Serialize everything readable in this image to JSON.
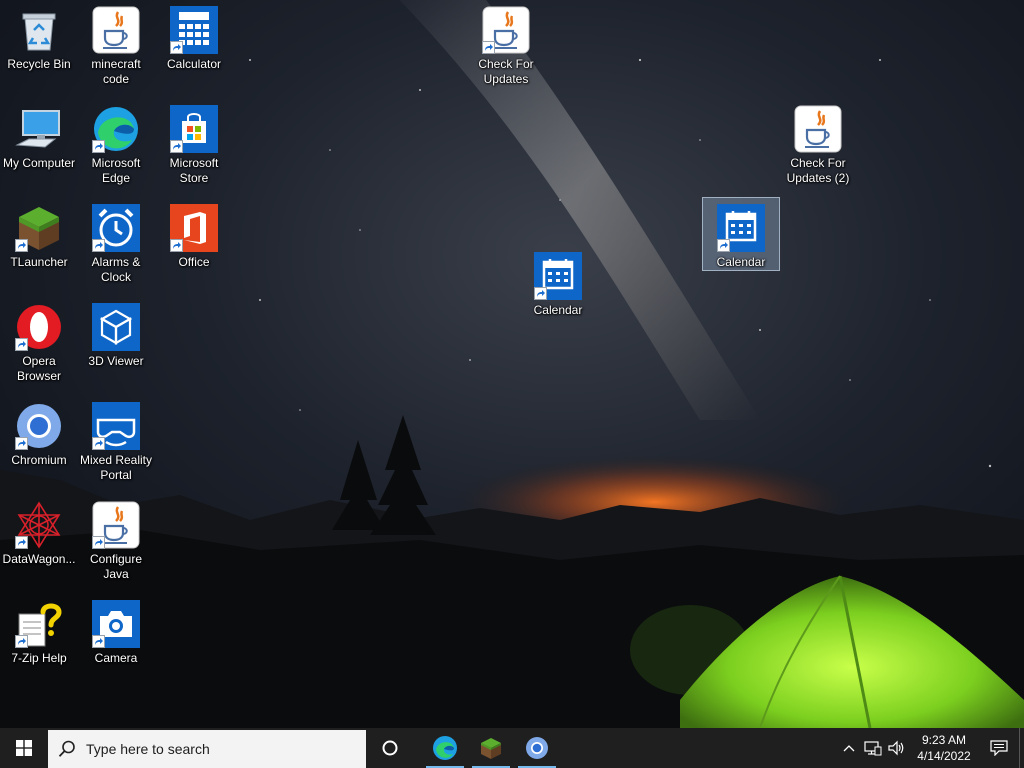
{
  "desktop": {
    "icons": [
      {
        "id": "recycle-bin",
        "label": "Recycle Bin",
        "icon": "recycle-bin-icon",
        "shortcut": false
      },
      {
        "id": "minecraft-code",
        "label": "minecraft code",
        "icon": "java-icon",
        "shortcut": false
      },
      {
        "id": "calculator",
        "label": "Calculator",
        "icon": "calculator-icon",
        "shortcut": true
      },
      {
        "id": "check-updates",
        "label": "Check For Updates",
        "icon": "java-icon",
        "shortcut": true
      },
      {
        "id": "my-computer",
        "label": "My Computer",
        "icon": "computer-icon",
        "shortcut": false
      },
      {
        "id": "edge",
        "label": "Microsoft Edge",
        "icon": "edge-icon",
        "shortcut": true
      },
      {
        "id": "store",
        "label": "Microsoft Store",
        "icon": "store-icon",
        "shortcut": true
      },
      {
        "id": "check-updates-2",
        "label": "Check For Updates (2)",
        "icon": "java-icon",
        "shortcut": false
      },
      {
        "id": "tlauncher",
        "label": "TLauncher",
        "icon": "grass-block-icon",
        "shortcut": true
      },
      {
        "id": "alarms",
        "label": "Alarms & Clock",
        "icon": "alarm-clock-icon",
        "shortcut": true
      },
      {
        "id": "office",
        "label": "Office",
        "icon": "office-icon",
        "shortcut": true
      },
      {
        "id": "calendar-selected",
        "label": "Calendar",
        "icon": "calendar-icon",
        "shortcut": true
      },
      {
        "id": "calendar",
        "label": "Calendar",
        "icon": "calendar-icon",
        "shortcut": true
      },
      {
        "id": "opera",
        "label": "Opera Browser",
        "icon": "opera-icon",
        "shortcut": true
      },
      {
        "id": "3d-viewer",
        "label": "3D Viewer",
        "icon": "cube-icon",
        "shortcut": false
      },
      {
        "id": "chromium",
        "label": "Chromium",
        "icon": "chromium-icon",
        "shortcut": true
      },
      {
        "id": "mixed-reality",
        "label": "Mixed Reality Portal",
        "icon": "headset-icon",
        "shortcut": true
      },
      {
        "id": "datawagon",
        "label": "DataWagon...",
        "icon": "datawagon-icon",
        "shortcut": true
      },
      {
        "id": "configure-java",
        "label": "Configure Java",
        "icon": "java-icon",
        "shortcut": true
      },
      {
        "id": "7zip-help",
        "label": "7-Zip Help",
        "icon": "help-file-icon",
        "shortcut": true
      },
      {
        "id": "camera",
        "label": "Camera",
        "icon": "camera-icon",
        "shortcut": true
      }
    ]
  },
  "taskbar": {
    "search_placeholder": "Type here to search",
    "pinned": [
      {
        "name": "Microsoft Edge",
        "icon": "edge-icon",
        "active": true
      },
      {
        "name": "TLauncher",
        "icon": "grass-block-icon",
        "active": true
      },
      {
        "name": "Chromium",
        "icon": "chromium-icon",
        "active": true
      }
    ],
    "time": "9:23 AM",
    "date": "4/14/2022"
  },
  "colors": {
    "taskbar": "#1f1f1f",
    "accent": "#0078d7",
    "tent": "#8fd82a",
    "glow": "#e0601e"
  }
}
